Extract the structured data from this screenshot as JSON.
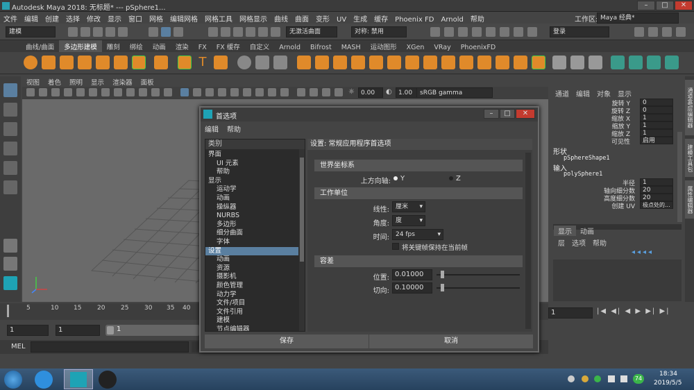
{
  "title": "Autodesk Maya 2018: 无标题*  ---  pSphere1...",
  "menu": [
    "文件",
    "编辑",
    "创建",
    "选择",
    "修改",
    "显示",
    "窗口",
    "网格",
    "编辑网格",
    "网格工具",
    "网格显示",
    "曲线",
    "曲面",
    "变形",
    "UV",
    "生成",
    "缓存",
    "Phoenix FD",
    "Arnold",
    "帮助"
  ],
  "workspace": {
    "label": "工作区:",
    "value": "Maya 经典*"
  },
  "toolbar": {
    "mode": "建模",
    "live_surface": "无激活曲面",
    "symmetry": "对称: 禁用",
    "login": "登录"
  },
  "shelf_tabs": [
    "曲线/曲面",
    "多边形建模",
    "雕刻",
    "绑绘",
    "动画",
    "渲染",
    "FX",
    "FX 缓存",
    "自定义",
    "Arnold",
    "Bifrost",
    "MASH",
    "运动图形",
    "XGen",
    "VRay",
    "PhoenixFD"
  ],
  "shelf_active": 1,
  "viewport_menu": [
    "视图",
    "着色",
    "照明",
    "显示",
    "渲染器",
    "面板"
  ],
  "viewport_tools": {
    "value1": "0.00",
    "value2": "1.00",
    "colorspace": "sRGB gamma"
  },
  "channel_menu": [
    "通道",
    "编辑",
    "对象",
    "显示"
  ],
  "channels": [
    {
      "name": "旋转 Y",
      "value": "0"
    },
    {
      "name": "旋转 Z",
      "value": "0"
    },
    {
      "name": "缩放 X",
      "value": "1"
    },
    {
      "name": "缩放 Y",
      "value": "1"
    },
    {
      "name": "缩放 Z",
      "value": "1"
    },
    {
      "name": "可见性",
      "value": "启用"
    }
  ],
  "shapes_label": "形状",
  "shape_name": "pSphereShape1",
  "inputs_label": "输入",
  "input_name": "polySphere1",
  "input_attrs": [
    {
      "name": "半径",
      "value": "1"
    },
    {
      "name": "轴向细分数",
      "value": "20"
    },
    {
      "name": "高度细分数",
      "value": "20"
    },
    {
      "name": "创建 UV",
      "value": "极点处的..."
    }
  ],
  "layer_tabs": [
    "显示",
    "动画"
  ],
  "layer_menu": [
    "层",
    "选项",
    "帮助"
  ],
  "side_tabs": [
    "通道盒/层编辑器",
    "建模工具包",
    "属性编辑器"
  ],
  "timeline_ticks": [
    "5",
    "10",
    "15",
    "20",
    "25",
    "30",
    "35",
    "40"
  ],
  "timeline_start": "1",
  "current_frame": "1",
  "range": {
    "start": "1",
    "start2": "1",
    "end": "1"
  },
  "mel_label": "MEL",
  "dialog": {
    "title": "首选项",
    "menu": [
      "编辑",
      "帮助"
    ],
    "category_header": "类别",
    "categories": [
      {
        "label": "界面",
        "indent": 0
      },
      {
        "label": "UI 元素",
        "indent": 1
      },
      {
        "label": "帮助",
        "indent": 1
      },
      {
        "label": "显示",
        "indent": 0
      },
      {
        "label": "运动学",
        "indent": 1
      },
      {
        "label": "动画",
        "indent": 1
      },
      {
        "label": "操纵器",
        "indent": 1
      },
      {
        "label": "NURBS",
        "indent": 1
      },
      {
        "label": "多边形",
        "indent": 1
      },
      {
        "label": "细分曲面",
        "indent": 1
      },
      {
        "label": "字体",
        "indent": 1
      },
      {
        "label": "设置",
        "indent": 0,
        "selected": true
      },
      {
        "label": "动画",
        "indent": 1
      },
      {
        "label": "资源",
        "indent": 1
      },
      {
        "label": "摄影机",
        "indent": 1
      },
      {
        "label": "颜色管理",
        "indent": 1
      },
      {
        "label": "动力学",
        "indent": 1
      },
      {
        "label": "文件/项目",
        "indent": 1
      },
      {
        "label": "文件引用",
        "indent": 1
      },
      {
        "label": "建模",
        "indent": 1
      },
      {
        "label": "节点编辑器",
        "indent": 1
      }
    ],
    "settings_header": "设置: 常规应用程序首选项",
    "world_coords": {
      "title": "世界坐标系",
      "up_axis_label": "上方向轴:",
      "y": "Y",
      "z": "Z"
    },
    "work_units": {
      "title": "工作单位",
      "linear_label": "线性:",
      "linear": "厘米",
      "angular_label": "角度:",
      "angular": "度",
      "time_label": "时间:",
      "time": "24 fps",
      "keep_keys": "将关键帧保持在当前帧"
    },
    "tolerance": {
      "title": "容差",
      "position_label": "位置:",
      "position": "0.01000",
      "tangent_label": "切向:",
      "tangent": "0.10000"
    },
    "save": "保存",
    "cancel": "取消"
  },
  "tray": {
    "time": "18:34",
    "date": "2019/5/5",
    "badge": "74"
  }
}
